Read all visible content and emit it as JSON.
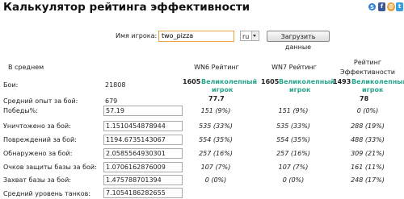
{
  "title": "Калькулятор рейтинга эффективности",
  "form": {
    "player_label": "Имя игрока:",
    "player_value": "two_pizza",
    "region": "ru",
    "load_button": "Загрузить данные"
  },
  "headers": {
    "average": "В среднем",
    "wn6": "WN6 Рейтинг",
    "wn7": "WN7 Рейтинг",
    "eff_line1": "Рейтинг",
    "eff_line2": "Эффективности"
  },
  "battles": {
    "label": "Бои:",
    "value": "21808"
  },
  "avg_xp": {
    "label": "Средний опыт за бой:",
    "value": "679"
  },
  "ratings": {
    "wn6": {
      "score": "1605",
      "grade_line1": "Великолепный",
      "grade_line2": "игрок",
      "value": "77.7"
    },
    "wn7": {
      "score": "1605",
      "grade_line1": "Великолепный",
      "grade_line2": "игрок",
      "value": ""
    },
    "eff": {
      "score": "1493",
      "grade_line1": "Великолепный",
      "grade_line2": "игрок",
      "value": "78"
    }
  },
  "rows": [
    {
      "label": "Победы%:",
      "value": "57.19",
      "wn6": "151 (9%)",
      "wn7": "151 (9%)",
      "eff": "0 (0%)"
    },
    {
      "label": "Уничтожено за бой:",
      "value": "1.1510454878944",
      "wn6": "535 (33%)",
      "wn7": "535 (33%)",
      "eff": "288 (19%)"
    },
    {
      "label": "Повреждений за бой:",
      "value": "1194.6735143067",
      "wn6": "554 (35%)",
      "wn7": "554 (35%)",
      "eff": "488 (33%)"
    },
    {
      "label": "Обнаружено за бой:",
      "value": "2.0585564930301",
      "wn6": "257 (16%)",
      "wn7": "257 (16%)",
      "eff": "309 (21%)"
    },
    {
      "label": "Очков защиты базы за бой:",
      "value": "1.0706162876009",
      "wn6": "107 (7%)",
      "wn7": "107 (7%)",
      "eff": "161 (11%)"
    },
    {
      "label": "Захват базы за бой:",
      "value": "1.475788701394",
      "wn6": "0 (0%)",
      "wn7": "0 (0%)",
      "eff": "248 (17%)"
    },
    {
      "label": "Средний уровень танков:",
      "value": "7.1054186282655",
      "wn6": "",
      "wn7": "",
      "eff": ""
    }
  ]
}
